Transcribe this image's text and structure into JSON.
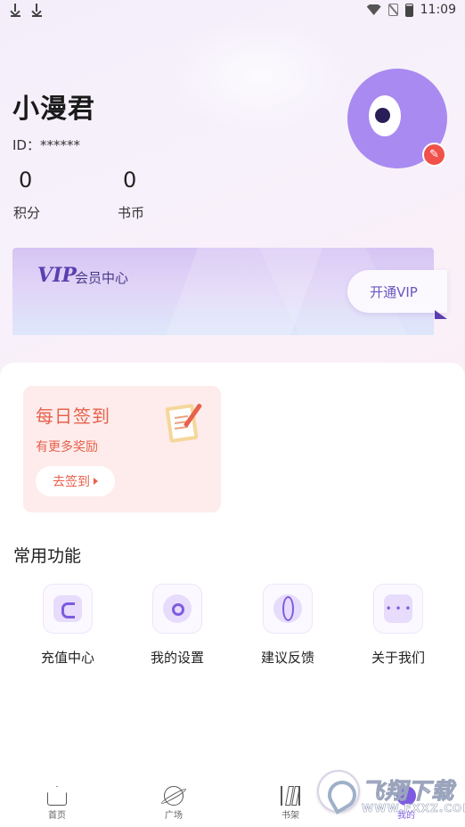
{
  "status_bar": {
    "time": "11:09",
    "icons": [
      "download-icon",
      "download-icon",
      "wifi-icon",
      "no-sim-icon",
      "battery-icon"
    ]
  },
  "profile": {
    "name": "小漫君",
    "id_text": "ID：******",
    "points_value": "0",
    "points_label": "积分",
    "coins_value": "0",
    "coins_label": "书币"
  },
  "vip": {
    "logo": "VIP",
    "title": "会员中心",
    "open_label": "开通VIP"
  },
  "checkin": {
    "title": "每日签到",
    "subtitle": "有更多奖励",
    "button_label": "去签到"
  },
  "functions": {
    "section_title": "常用功能",
    "items": [
      {
        "label": "充值中心",
        "icon": "recharge-icon"
      },
      {
        "label": "我的设置",
        "icon": "gear-icon"
      },
      {
        "label": "建议反馈",
        "icon": "feedback-icon"
      },
      {
        "label": "关于我们",
        "icon": "about-icon"
      }
    ]
  },
  "tabbar": {
    "items": [
      {
        "label": "首页",
        "icon": "home-icon"
      },
      {
        "label": "广场",
        "icon": "planet-icon"
      },
      {
        "label": "书架",
        "icon": "bookshelf-icon"
      },
      {
        "label": "我的",
        "icon": "profile-icon"
      }
    ],
    "active_index": 3
  },
  "watermark": {
    "text": "飞翔下载",
    "url": "WWW.FXXZ.COM"
  },
  "colors": {
    "accent": "#7d5be0",
    "checkin": "#e8604c",
    "avatar": "#a88af0"
  }
}
